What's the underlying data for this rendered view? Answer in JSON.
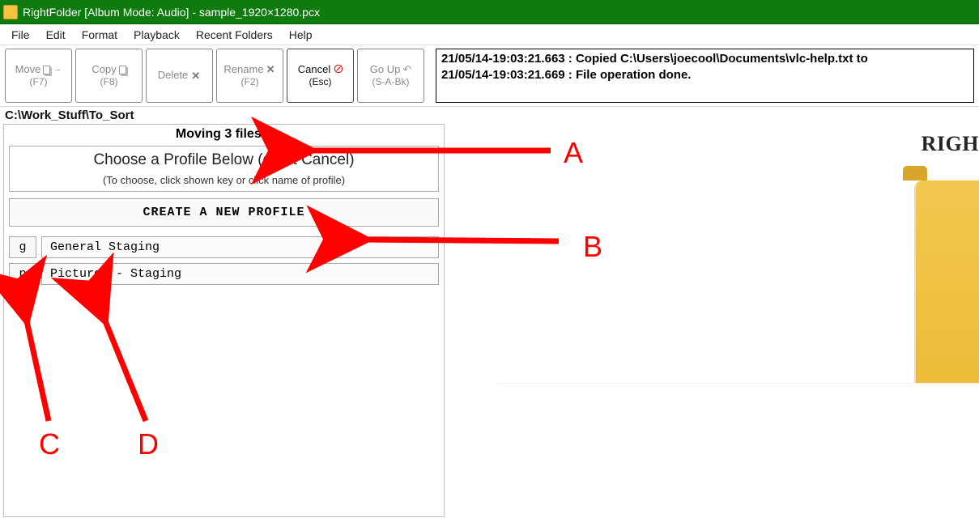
{
  "title": "RightFolder [Album Mode: Audio] - sample_1920×1280.pcx",
  "menus": {
    "file": "File",
    "edit": "Edit",
    "format": "Format",
    "playback": "Playback",
    "recent": "Recent Folders",
    "help": "Help"
  },
  "toolbar": {
    "move": {
      "label": "Move",
      "hot": "(F7)"
    },
    "copy": {
      "label": "Copy",
      "hot": "(F8)"
    },
    "delete": {
      "label": "Delete",
      "hot": ""
    },
    "rename": {
      "label": "Rename",
      "hot": "(F2)"
    },
    "cancel": {
      "label": "Cancel",
      "hot": "(Esc)"
    },
    "goup": {
      "label": "Go Up",
      "hot": "(S-A-Bk)"
    }
  },
  "log": {
    "l1": "21/05/14-19:03:21.663 : Copied C:\\Users\\joecool\\Documents\\vlc-help.txt to",
    "l2": "21/05/14-19:03:21.669 : File operation done."
  },
  "path": "C:\\Work_Stuff\\To_Sort",
  "panel": {
    "op_title": "Moving 3 files...",
    "choose_main": "Choose a Profile Below (or hit Cancel)",
    "choose_sub": "(To choose, click shown key or click name of profile)",
    "create_label": "CREATE A NEW PROFILE",
    "profiles": [
      {
        "key": "g",
        "name": "General Staging"
      },
      {
        "key": "p",
        "name": "Pictures - Staging"
      }
    ]
  },
  "right": {
    "banner": "Righ"
  },
  "annotations": {
    "A": "A",
    "B": "B",
    "C": "C",
    "D": "D"
  }
}
